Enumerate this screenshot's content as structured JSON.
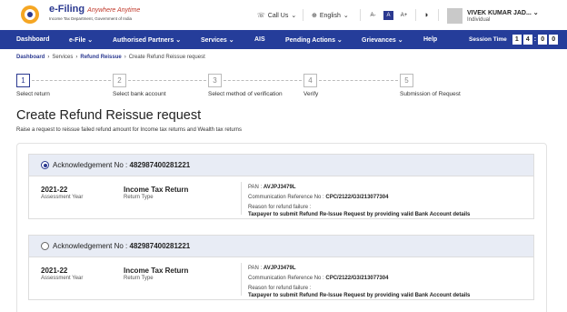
{
  "header": {
    "brand_title": "e-Filing",
    "brand_tagline": "Anywhere Anytime",
    "brand_subtitle": "Income Tax Department, Government of India",
    "call_us": "Call Us",
    "language": "English",
    "font_small": "A-",
    "font_normal": "A",
    "font_large": "A+",
    "user_name": "VIVEK KUMAR JAD...",
    "user_role": "Individual"
  },
  "nav": {
    "items": [
      "Dashboard",
      "e-File",
      "Authorised Partners",
      "Services",
      "AIS",
      "Pending Actions",
      "Grievances",
      "Help"
    ],
    "session_label": "Session Time",
    "time_digits": [
      "1",
      "4",
      "0",
      "0"
    ]
  },
  "breadcrumb": [
    "Dashboard",
    "Services",
    "Refund Reissue",
    "Create Refund Reissue request"
  ],
  "steps": [
    {
      "num": "1",
      "label": "Select return"
    },
    {
      "num": "2",
      "label": "Select bank account"
    },
    {
      "num": "3",
      "label": "Select method of verification"
    },
    {
      "num": "4",
      "label": "Verify"
    },
    {
      "num": "5",
      "label": "Submission of Request"
    }
  ],
  "page": {
    "title": "Create Refund Reissue request",
    "description": "Raise a request to reissue failed refund amount for Income tax returns and Wealth tax returns"
  },
  "cards": [
    {
      "selected": true,
      "ack_label": "Acknowledgement No :",
      "ack_no": "482987400281221",
      "assessment_year": "2021-22",
      "ay_label": "Assessment Year",
      "return_type": "Income Tax Return",
      "rt_label": "Return Type",
      "pan_label": "PAN :",
      "pan": "AVJPJ3479L",
      "comm_label": "Communication Reference No :",
      "comm_ref": "CPC/2122/G3/213077304",
      "reason_label": "Reason for refund failure :",
      "reason": "Taxpayer to submit Refund Re-Issue Request by providing valid Bank Account details"
    },
    {
      "selected": false,
      "ack_label": "Acknowledgement No :",
      "ack_no": "482987400281221",
      "assessment_year": "2021-22",
      "ay_label": "Assessment Year",
      "return_type": "Income Tax Return",
      "rt_label": "Return Type",
      "pan_label": "PAN :",
      "pan": "AVJPJ3479L",
      "comm_label": "Communication Reference No :",
      "comm_ref": "CPC/2122/G3/213077304",
      "reason_label": "Reason for refund failure :",
      "reason": "Taxpayer to submit Refund Re-Issue Request by providing valid Bank Account details"
    }
  ],
  "colors": {
    "primary": "#253d9a",
    "card_header": "#e8ecf5"
  }
}
